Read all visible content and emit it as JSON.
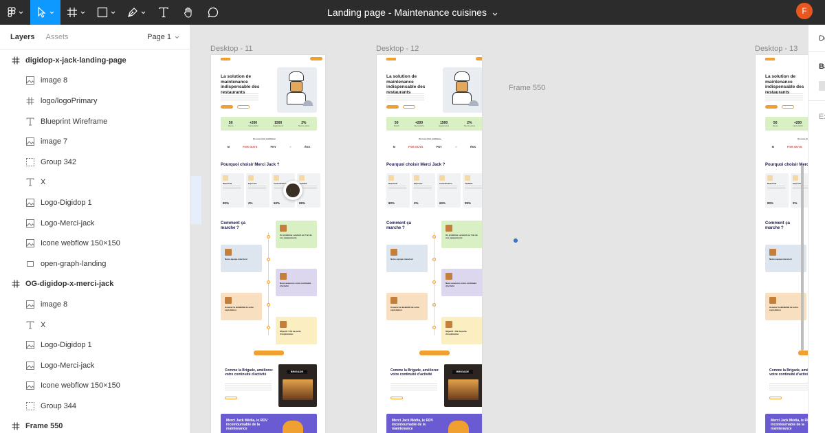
{
  "toolbar": {
    "tools": [
      {
        "name": "main-menu",
        "icon": "figma-logo-icon",
        "active": false
      },
      {
        "name": "move",
        "icon": "move-cursor-icon",
        "active": true
      },
      {
        "name": "frame",
        "icon": "frame-grid-icon",
        "active": false
      },
      {
        "name": "shape",
        "icon": "rectangle-icon",
        "active": false
      },
      {
        "name": "pen",
        "icon": "pen-icon",
        "active": false
      },
      {
        "name": "text",
        "icon": "text-icon",
        "active": false
      },
      {
        "name": "hand",
        "icon": "hand-icon",
        "active": false
      },
      {
        "name": "comment",
        "icon": "comment-icon",
        "active": false
      }
    ],
    "document_title": "Landing page - Maintenance cuisines",
    "user_initial": "F",
    "accent": "#0d99ff",
    "avatar_color": "#e8571f"
  },
  "left_panel": {
    "tabs": {
      "layers": "Layers",
      "assets": "Assets"
    },
    "page_selector": "Page 1",
    "layers": [
      {
        "label": "digidop-x-jack-landing-page",
        "kind": "frame",
        "level": 0
      },
      {
        "label": "image 8",
        "kind": "image",
        "level": 1
      },
      {
        "label": "logo/logoPrimary",
        "kind": "frame",
        "level": 1
      },
      {
        "label": "Blueprint Wireframe",
        "kind": "text",
        "level": 1
      },
      {
        "label": "image 7",
        "kind": "image",
        "level": 1
      },
      {
        "label": "Group 342",
        "kind": "group",
        "level": 1
      },
      {
        "label": "X",
        "kind": "text",
        "level": 1
      },
      {
        "label": "Logo-Digidop 1",
        "kind": "image",
        "level": 1
      },
      {
        "label": "Logo-Merci-jack",
        "kind": "image",
        "level": 1
      },
      {
        "label": "Icone webflow 150×150",
        "kind": "image",
        "level": 1
      },
      {
        "label": "open-graph-landing",
        "kind": "rect",
        "level": 1
      },
      {
        "label": "OG-digidop-x-merci-jack",
        "kind": "frame",
        "level": 0
      },
      {
        "label": "image 8",
        "kind": "image",
        "level": 1
      },
      {
        "label": "X",
        "kind": "text",
        "level": 1
      },
      {
        "label": "Logo-Digidop 1",
        "kind": "image",
        "level": 1
      },
      {
        "label": "Logo-Merci-jack",
        "kind": "image",
        "level": 1
      },
      {
        "label": "Icone webflow 150×150",
        "kind": "image",
        "level": 1
      },
      {
        "label": "Group 344",
        "kind": "group",
        "level": 1
      },
      {
        "label": "Frame 550",
        "kind": "frame",
        "level": 0
      }
    ]
  },
  "canvas": {
    "frames": [
      {
        "label": "Desktop - 11"
      },
      {
        "label": "Desktop - 12"
      },
      {
        "label": "Desktop - 13"
      }
    ],
    "floating_label": "Frame 550",
    "page": {
      "hero_title": "La solution de maintenance indispensable des restaurants",
      "stats": [
        {
          "value": "50",
          "label": "Clients"
        },
        {
          "value": "+200",
          "label": "Interventions"
        },
        {
          "value": "1500",
          "label": "Equipements"
        },
        {
          "value": "2%",
          "label": "Taux de panne"
        }
      ],
      "trust_title": "Ils nous font confiance",
      "partner_logos": [
        "M",
        "FIVE GUYS",
        "PNY",
        "♂",
        "ÉKK"
      ],
      "why_title": "Pourquoi choisir Merci Jack ?",
      "why_cards": [
        {
          "title": "Réactivité",
          "pct": "80%"
        },
        {
          "title": "Expertise",
          "pct": "2%"
        },
        {
          "title": "Centralisation",
          "pct": "60%"
        },
        {
          "title": "Visibilité",
          "pct": "95%"
        }
      ],
      "how_title": "Comment ça marche ?",
      "steps": [
        {
          "title": "Un problème survient sur l'un de vos équipements"
        },
        {
          "title": "Notre équipe intervient"
        },
        {
          "title": "Nous assurons votre continuité d'activité"
        },
        {
          "title": "Assurez la durabilité de votre exploitation"
        },
        {
          "title": "Objectif ! 0% de perte d'exploitation"
        }
      ],
      "brigade_title": "Comme la Brigade, améliorez votre continuité d'activité",
      "brigade_sign": "BRIGADE",
      "media_title": "Merci Jack Média, le RDV incontournable de la maintenance"
    }
  },
  "right_panel": {
    "texts": [
      "De",
      "Ba",
      "Ex"
    ]
  },
  "colors": {
    "toolbar_bg": "#2c2c2c",
    "canvas_bg": "#e5e5e5",
    "orange": "#f0a030",
    "green": "#d9f0c4",
    "lavender": "#dcd6ee",
    "peach": "#f7dfbf",
    "light_blue": "#dde6ef",
    "purple": "#6b5bd2"
  }
}
